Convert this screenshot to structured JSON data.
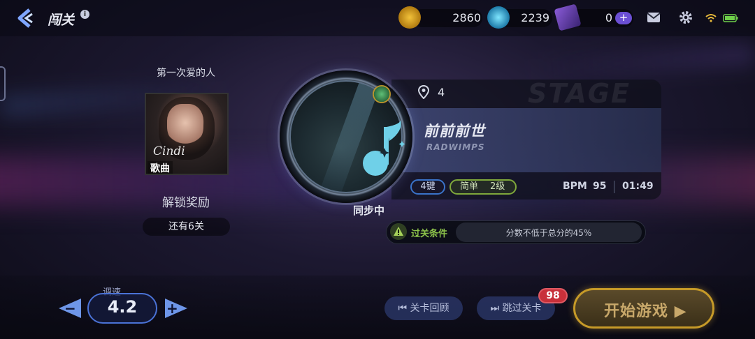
{
  "header": {
    "title": "闯关",
    "info_label": "i",
    "currencies": [
      {
        "name": "music-coin",
        "value": "2860"
      },
      {
        "name": "diamond",
        "value": "2239"
      },
      {
        "name": "ticket",
        "value": "0"
      }
    ],
    "plus_label": "+"
  },
  "left_card": {
    "song_name": "第一次爱的人",
    "album_brand": "Cindi",
    "album_tag": "歌曲",
    "unlock_title": "解锁奖励",
    "remaining": "还有6关"
  },
  "disc": {
    "sync_status": "同步中"
  },
  "song_panel": {
    "location_number": "4",
    "bg_text": "STAGE",
    "title": "前前前世",
    "artist": "RADWIMPS",
    "keys": "4键",
    "difficulty": "简单",
    "level": "2级",
    "bpm_label": "BPM",
    "bpm": "95",
    "duration": "01:49"
  },
  "condition": {
    "label": "过关条件",
    "text": "分数不低于总分的45%"
  },
  "bottom": {
    "speed_label": "调速",
    "speed_value": "4.2",
    "minus": "−",
    "plus": "+",
    "review_label": "关卡回顾",
    "skip_label": "跳过关卡",
    "skip_count": "98",
    "start_label": "开始游戏 ▶"
  },
  "colors": {
    "accent_blue": "#4a72d6",
    "accent_gold": "#c69a28",
    "condition_green": "#8cc24a",
    "badge_red": "#c8303a",
    "note_cyan": "#6fd0e8"
  }
}
